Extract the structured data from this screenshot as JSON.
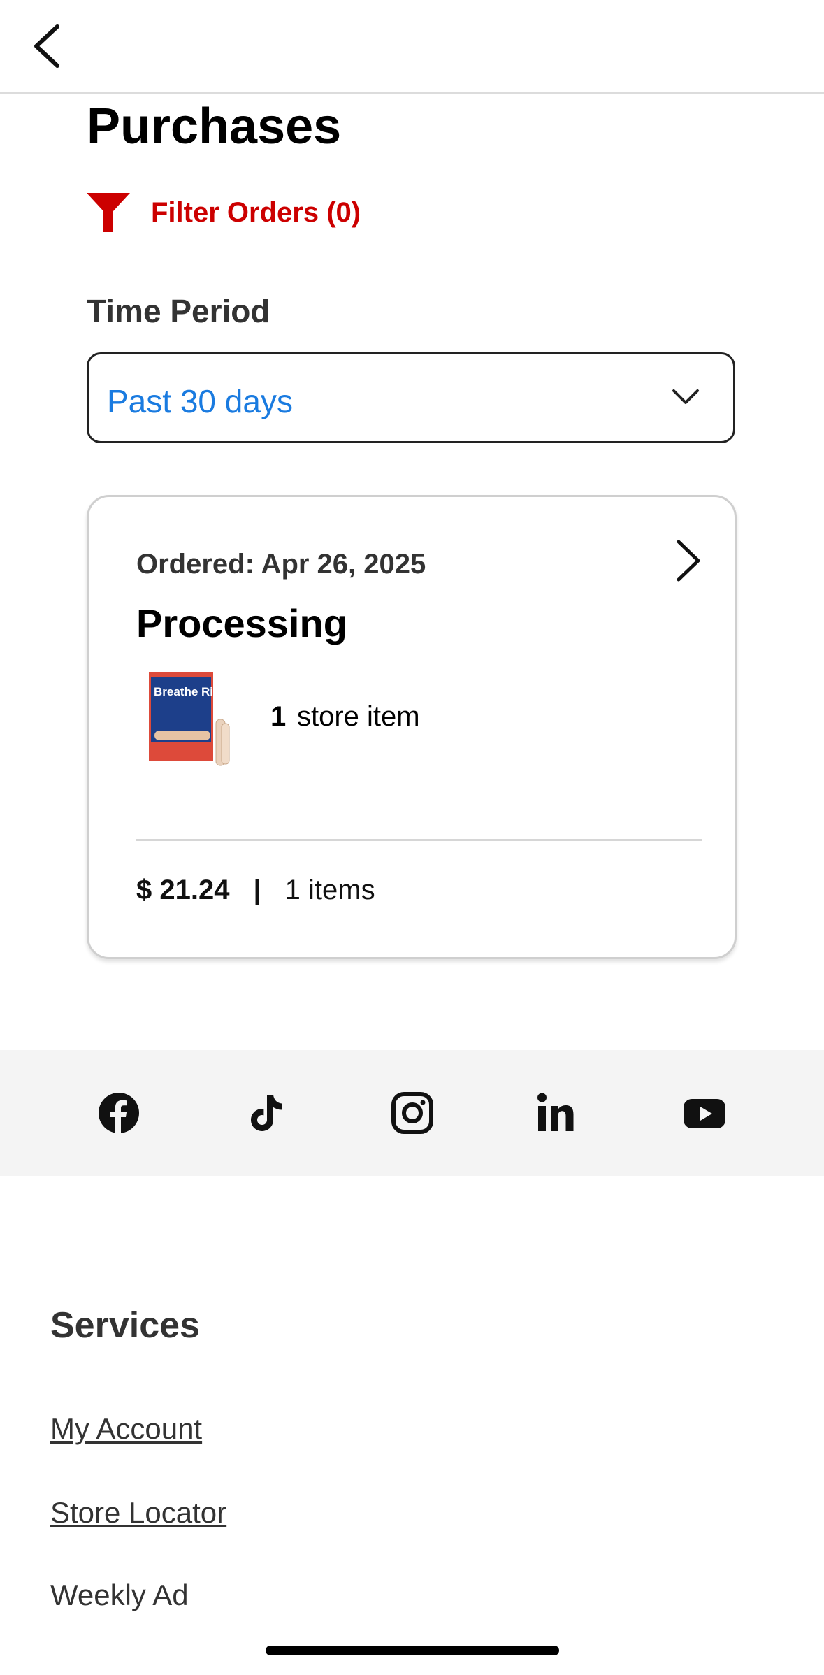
{
  "page": {
    "title": "Purchases",
    "filter_label": "Filter Orders (0)",
    "time_period_label": "Time Period",
    "time_period_value": "Past 30 days"
  },
  "order": {
    "ordered_label": "Ordered: Apr 26, 2025",
    "status": "Processing",
    "store_item_count": "1",
    "store_item_text": "store item",
    "price": "$ 21.24",
    "separator": "|",
    "items_text": "1 items",
    "thumbnail_text": "Breathe Right"
  },
  "social": [
    "facebook-icon",
    "tiktok-icon",
    "instagram-icon",
    "linkedin-icon",
    "youtube-icon"
  ],
  "footer": {
    "services_title": "Services",
    "links": [
      "My Account",
      "Store Locator",
      "Weekly Ad"
    ]
  },
  "colors": {
    "brand_red": "#cc0000",
    "select_value": "#1a7be0"
  }
}
